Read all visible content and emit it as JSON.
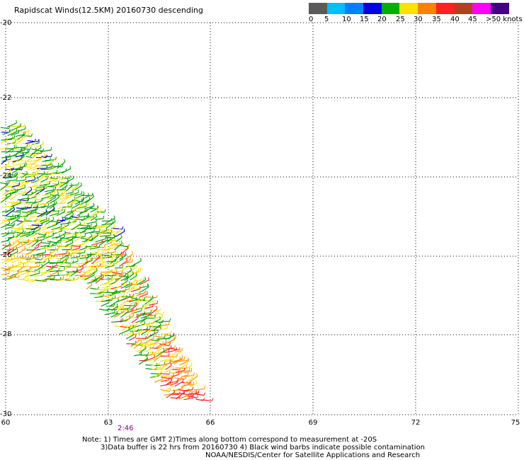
{
  "title": "Rapidscat Winds(12.5KM) 20160730 descending",
  "legend": {
    "labels": [
      "0",
      "5",
      "10",
      "15",
      "20",
      "25",
      "30",
      "35",
      "40",
      "45",
      ">50 knots"
    ],
    "colors": [
      "#5a5a5a",
      "#00bfff",
      "#0080ff",
      "#0000e0",
      "#00b000",
      "#ffe000",
      "#ff8000",
      "#ff2020",
      "#b04020",
      "#ff00ff",
      "#400080"
    ]
  },
  "axes": {
    "y_labels": [
      "-20",
      "-22",
      "-24",
      "-26",
      "-28",
      "-30"
    ],
    "x_labels": [
      "60",
      "63",
      "66",
      "69",
      "72",
      "75"
    ],
    "grid": "dotted"
  },
  "time_label": "2:46",
  "notes": [
    "Note: 1) Times are GMT 2)Times along bottom correspond to measurement at -20S",
    "3)Data buffer is 22 hrs from 20160730 4) Black wind barbs indicate possible contamination",
    "NOAA/NESDIS/Center for Satellite Applications and Research"
  ],
  "swath_colors": {
    "green": "#00a000",
    "yellow": "#ffe000",
    "orange": "#ff9000",
    "red": "#ff2020",
    "blue": "#0000c0"
  }
}
